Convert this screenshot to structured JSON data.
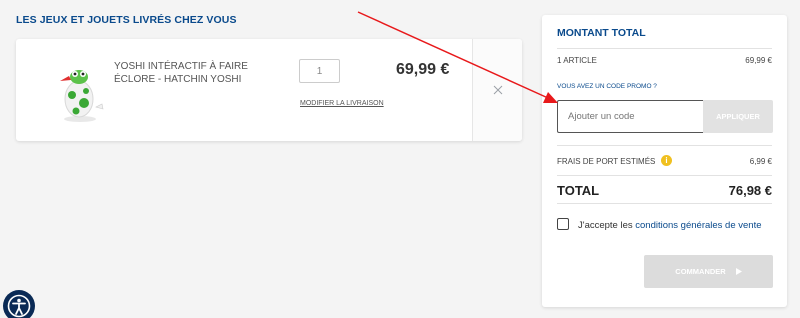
{
  "cart": {
    "section_title": "LES JEUX ET JOUETS LIVRÉS CHEZ VOUS",
    "item": {
      "name": "YOSHI INTÉRACTIF À FAIRE ÉCLORE - HATCHIN YOSHI",
      "quantity": "1",
      "price": "69,99 €",
      "modify_label": "MODIFIER LA LIVRAISON",
      "remove_icon": "close-icon",
      "image_icon": "yoshi-egg-icon"
    }
  },
  "summary": {
    "title": "MONTANT TOTAL",
    "articles_label": "1 ARTICLE",
    "articles_value": "69,99 €",
    "promo_label": "VOUS AVEZ UN CODE PROMO ?",
    "promo_placeholder": "Ajouter un code",
    "apply_label": "APPLIQUER",
    "shipping_label": "FRAIS DE PORT ESTIMÉS",
    "shipping_info_icon": "info-icon",
    "shipping_value": "6,99 €",
    "total_label": "TOTAL",
    "total_value": "76,98 €",
    "terms_prefix": "J'accepte les",
    "terms_link": "conditions générales de vente",
    "order_label": "COMMANDER",
    "order_icon": "play-arrow-icon"
  },
  "accessibility_icon": "accessibility-icon",
  "colors": {
    "brand_blue": "#0a4a8c",
    "annotation_arrow": "#e8191b",
    "info_yellow": "#f0c020",
    "disabled_gray": "#dcdcdc"
  }
}
